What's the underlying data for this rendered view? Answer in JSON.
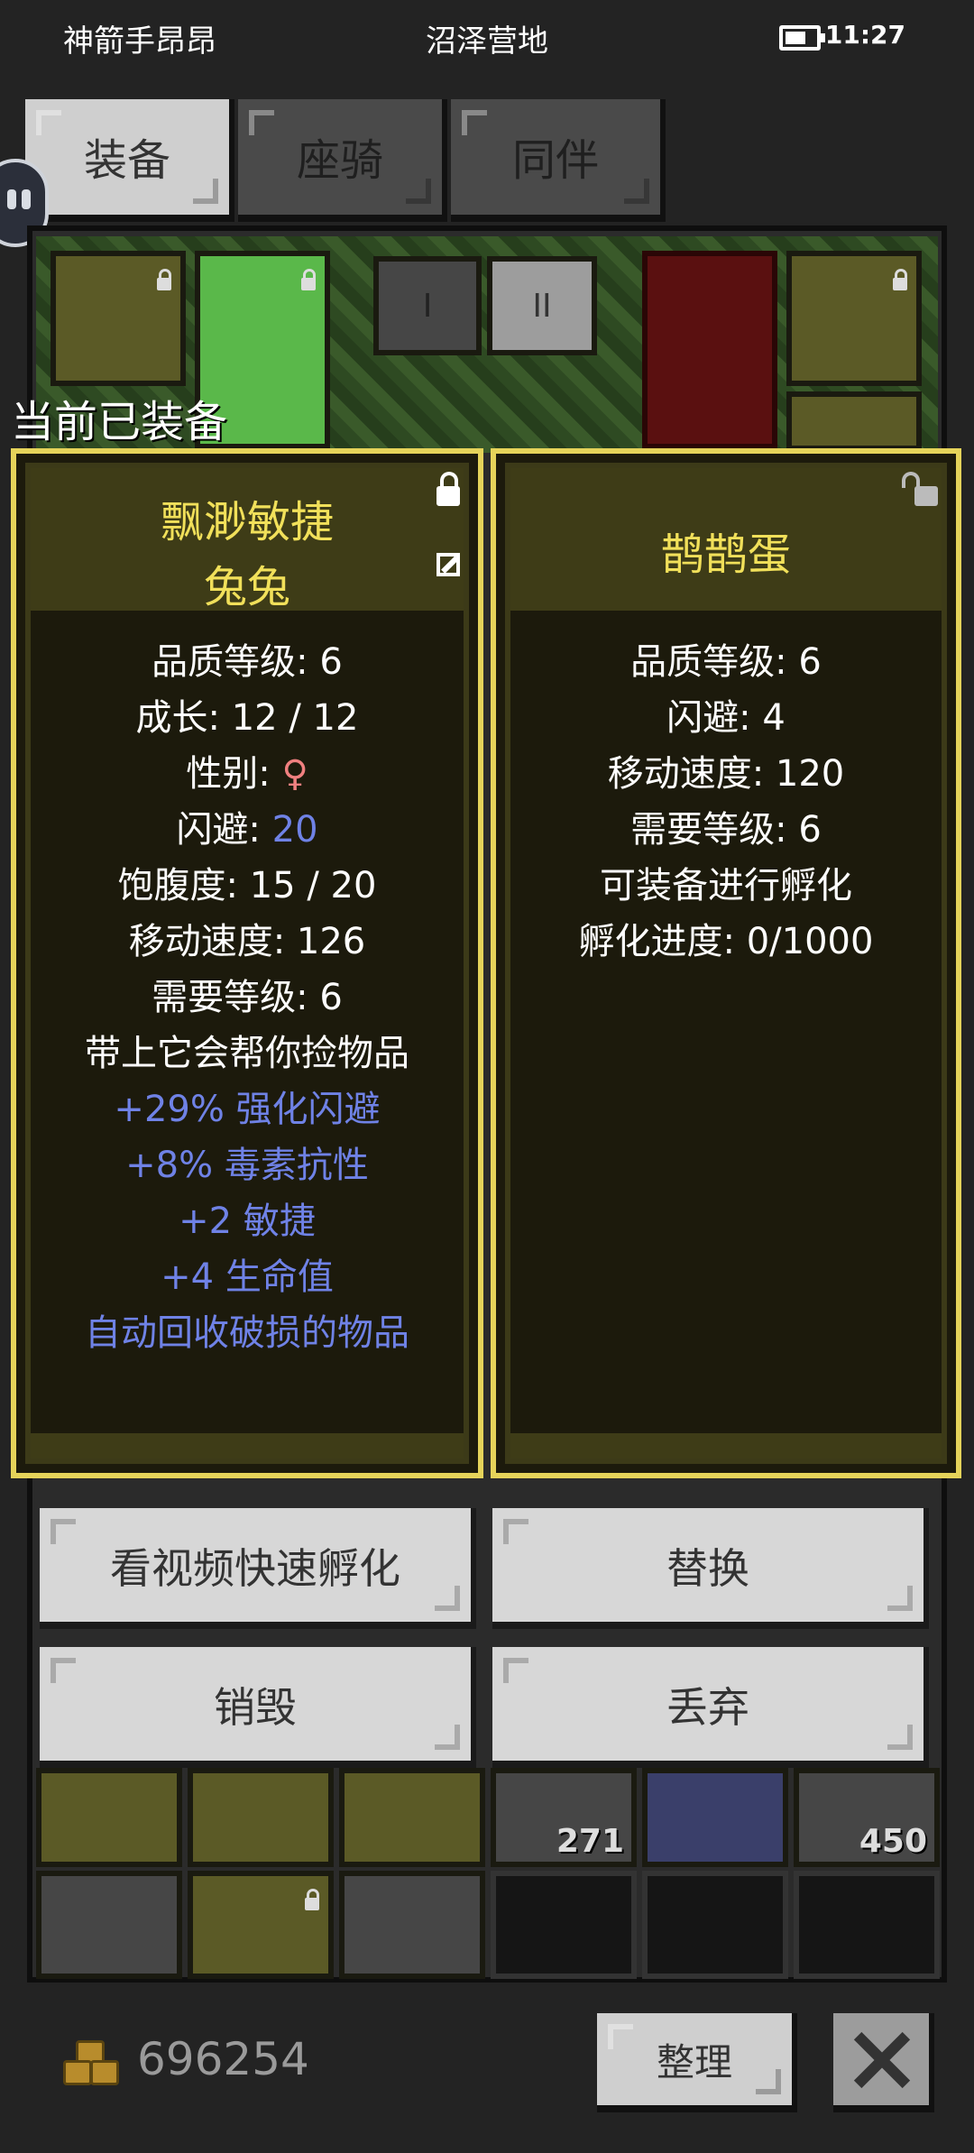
{
  "status_bar": {
    "player_name": "神箭手昂昂",
    "location": "沼泽营地",
    "time": "11:27",
    "battery_level": 0.7
  },
  "tabs": [
    {
      "label": "装备",
      "active": true
    },
    {
      "label": "座骑",
      "active": false
    },
    {
      "label": "同伴",
      "active": false
    }
  ],
  "equip_switch": {
    "set_1": "I",
    "set_2": "II"
  },
  "equipped_label": "当前已装备",
  "current_item": {
    "name": "飘渺敏捷",
    "subname": "兔兔",
    "quality_label": "品质等级: 6",
    "growth_label": "成长: 12 / 12",
    "gender_prefix": "性别: ",
    "gender_value": "♀",
    "dodge_prefix": "闪避: ",
    "dodge_value": "20",
    "satiety_label": "饱腹度: 15 / 20",
    "speed_label": "移动速度: 126",
    "level_req_label": "需要等级: 6",
    "desc": "带上它会帮你捡物品",
    "bonuses": [
      "+29% 强化闪避",
      "+8% 毒素抗性",
      "+2 敏捷",
      "+4 生命值",
      "自动回收破损的物品"
    ]
  },
  "new_item": {
    "name": "鹊鹊蛋",
    "quality_label": "品质等级: 6",
    "dodge_label": "闪避: 4",
    "speed_label": "移动速度: 120",
    "level_req_label": "需要等级: 6",
    "note1": "可装备进行孵化",
    "note2": "孵化进度: 0/1000"
  },
  "actions": {
    "watch_video_hatch": "看视频快速孵化",
    "replace": "替换",
    "destroy": "销毁",
    "discard": "丢弃"
  },
  "inventory_counts": [
    "271",
    "450"
  ],
  "footer": {
    "gold": "696254",
    "sort_label": "整理"
  },
  "colors": {
    "panel_border": "#e5d35a",
    "title_yellow": "#f1e05a",
    "bonus_blue": "#6f82e6",
    "female_pink": "#f08080"
  }
}
